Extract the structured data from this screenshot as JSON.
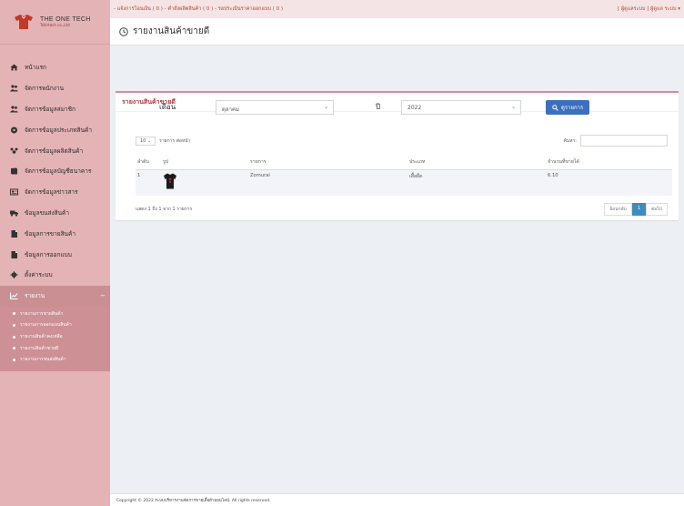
{
  "brand": {
    "name": "THE ONE TECH",
    "tagline": "Tshirtech co.,Ltd"
  },
  "sidebar": {
    "items": [
      {
        "label": "หน้าแรก",
        "icon": "home-icon"
      },
      {
        "label": "จัดการพนักงาน",
        "icon": "users-icon"
      },
      {
        "label": "จัดการข้อมูลสมาชิก",
        "icon": "users-icon"
      },
      {
        "label": "จัดการข้อมูลประเภทสินค้า",
        "icon": "gamepad-icon"
      },
      {
        "label": "จัดการข้อมูลผลิตสินค้า",
        "icon": "group-icon"
      },
      {
        "label": "จัดการข้อมูลบัญชีธนาคาร",
        "icon": "book-icon"
      },
      {
        "label": "จัดการข้อมูลข่าวสาร",
        "icon": "newspaper-icon"
      },
      {
        "label": "ข้อมูลขนส่งสินค้า",
        "icon": "truck-icon"
      },
      {
        "label": "ข้อมูลการขายสินค้า",
        "icon": "file-icon"
      },
      {
        "label": "ข้อมูลการออกแบบ",
        "icon": "file-icon"
      },
      {
        "label": "ตั้งค่าระบบ",
        "icon": "gear-icon"
      }
    ],
    "active": {
      "label": "รายงาน",
      "icon": "chart-icon",
      "caret": "−"
    },
    "submenu": [
      "รายงานการขายสินค้า",
      "รายงานการออกแบบสินค้า",
      "รายงานสินค้าคงเหลือ",
      "รายงานสินค้าขายดี",
      "รายงานการขนส่งสินค้า"
    ]
  },
  "topbar": {
    "links": "- แจ้งการโอนเงิน ( 0 )  - คำสั่งผลิตสินค้า ( 0 )  - รอประเมินราคาออกแบบ ( 0 )",
    "user": "[ ผู้ดูแลระบบ ] ผู้ดูแล ระบบ ▾"
  },
  "page": {
    "title": "รายงานสินค้าขายดี"
  },
  "box": {
    "title": "รายงานสินค้าขายดี"
  },
  "filter": {
    "month_label": "เดือน",
    "month_value": "ตุลาคม",
    "year_label": "ปี",
    "year_value": "2022",
    "search_button": "ดูรายการ"
  },
  "table_controls": {
    "length_value": "10",
    "length_text": "รายการ ต่อหน้า",
    "search_label": "ค้นหา:"
  },
  "table": {
    "headers": [
      "ลำดับ",
      "รูป",
      "รายการ",
      "ประเภท",
      "จำนวนที่ขายได้"
    ],
    "rows": [
      {
        "no": "1",
        "name": "Zomurai",
        "type": "เสื้อยืด",
        "qty": "6.10"
      }
    ]
  },
  "info": "แสดง 1 ถึง 1 จาก 1 รายการ",
  "pager": {
    "prev": "ย้อนกลับ",
    "current": "1",
    "next": "ต่อไป"
  },
  "footer": "Copyright © 2022 ระบบบริหารงานจัดการขายเสื้อผ้าออนไลน์. All rights reserved.",
  "colors": {
    "sidebar": "#e4b3b5",
    "sidebar_active": "#c98f93",
    "accent": "#b03a45",
    "button": "#3c6fbf"
  }
}
